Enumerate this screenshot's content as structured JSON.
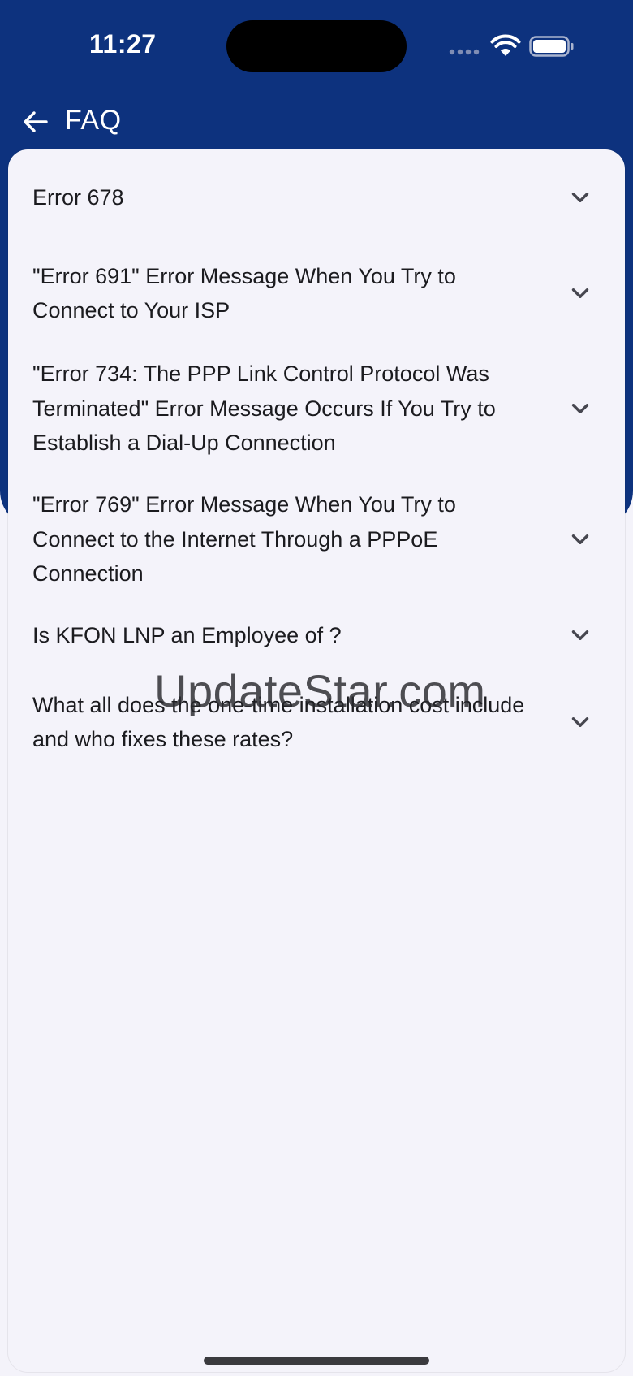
{
  "status_bar": {
    "time": "11:27"
  },
  "app_bar": {
    "title": "FAQ",
    "back_icon": "arrow-left-icon"
  },
  "faq": {
    "items": [
      {
        "question": "Error 678"
      },
      {
        "question": "\"Error 691\" Error Message When You Try to Connect to Your ISP"
      },
      {
        "question": "\"Error 734: The PPP Link Control Protocol Was Terminated\" Error Message Occurs If You Try to Establish a Dial-Up Connection"
      },
      {
        "question": "\"Error 769\" Error Message When You Try to Connect to the Internet Through a PPPoE Connection"
      },
      {
        "question": "Is KFON LNP an Employee of ?"
      },
      {
        "question": "What all does the one-time installation cost include and who fixes these rates?"
      }
    ],
    "expand_icon": "chevron-down-icon"
  },
  "watermark": "UpdateStar.com",
  "colors": {
    "header": "#0d327e",
    "background": "#f4f3fa",
    "text": "#1b1b1f"
  }
}
